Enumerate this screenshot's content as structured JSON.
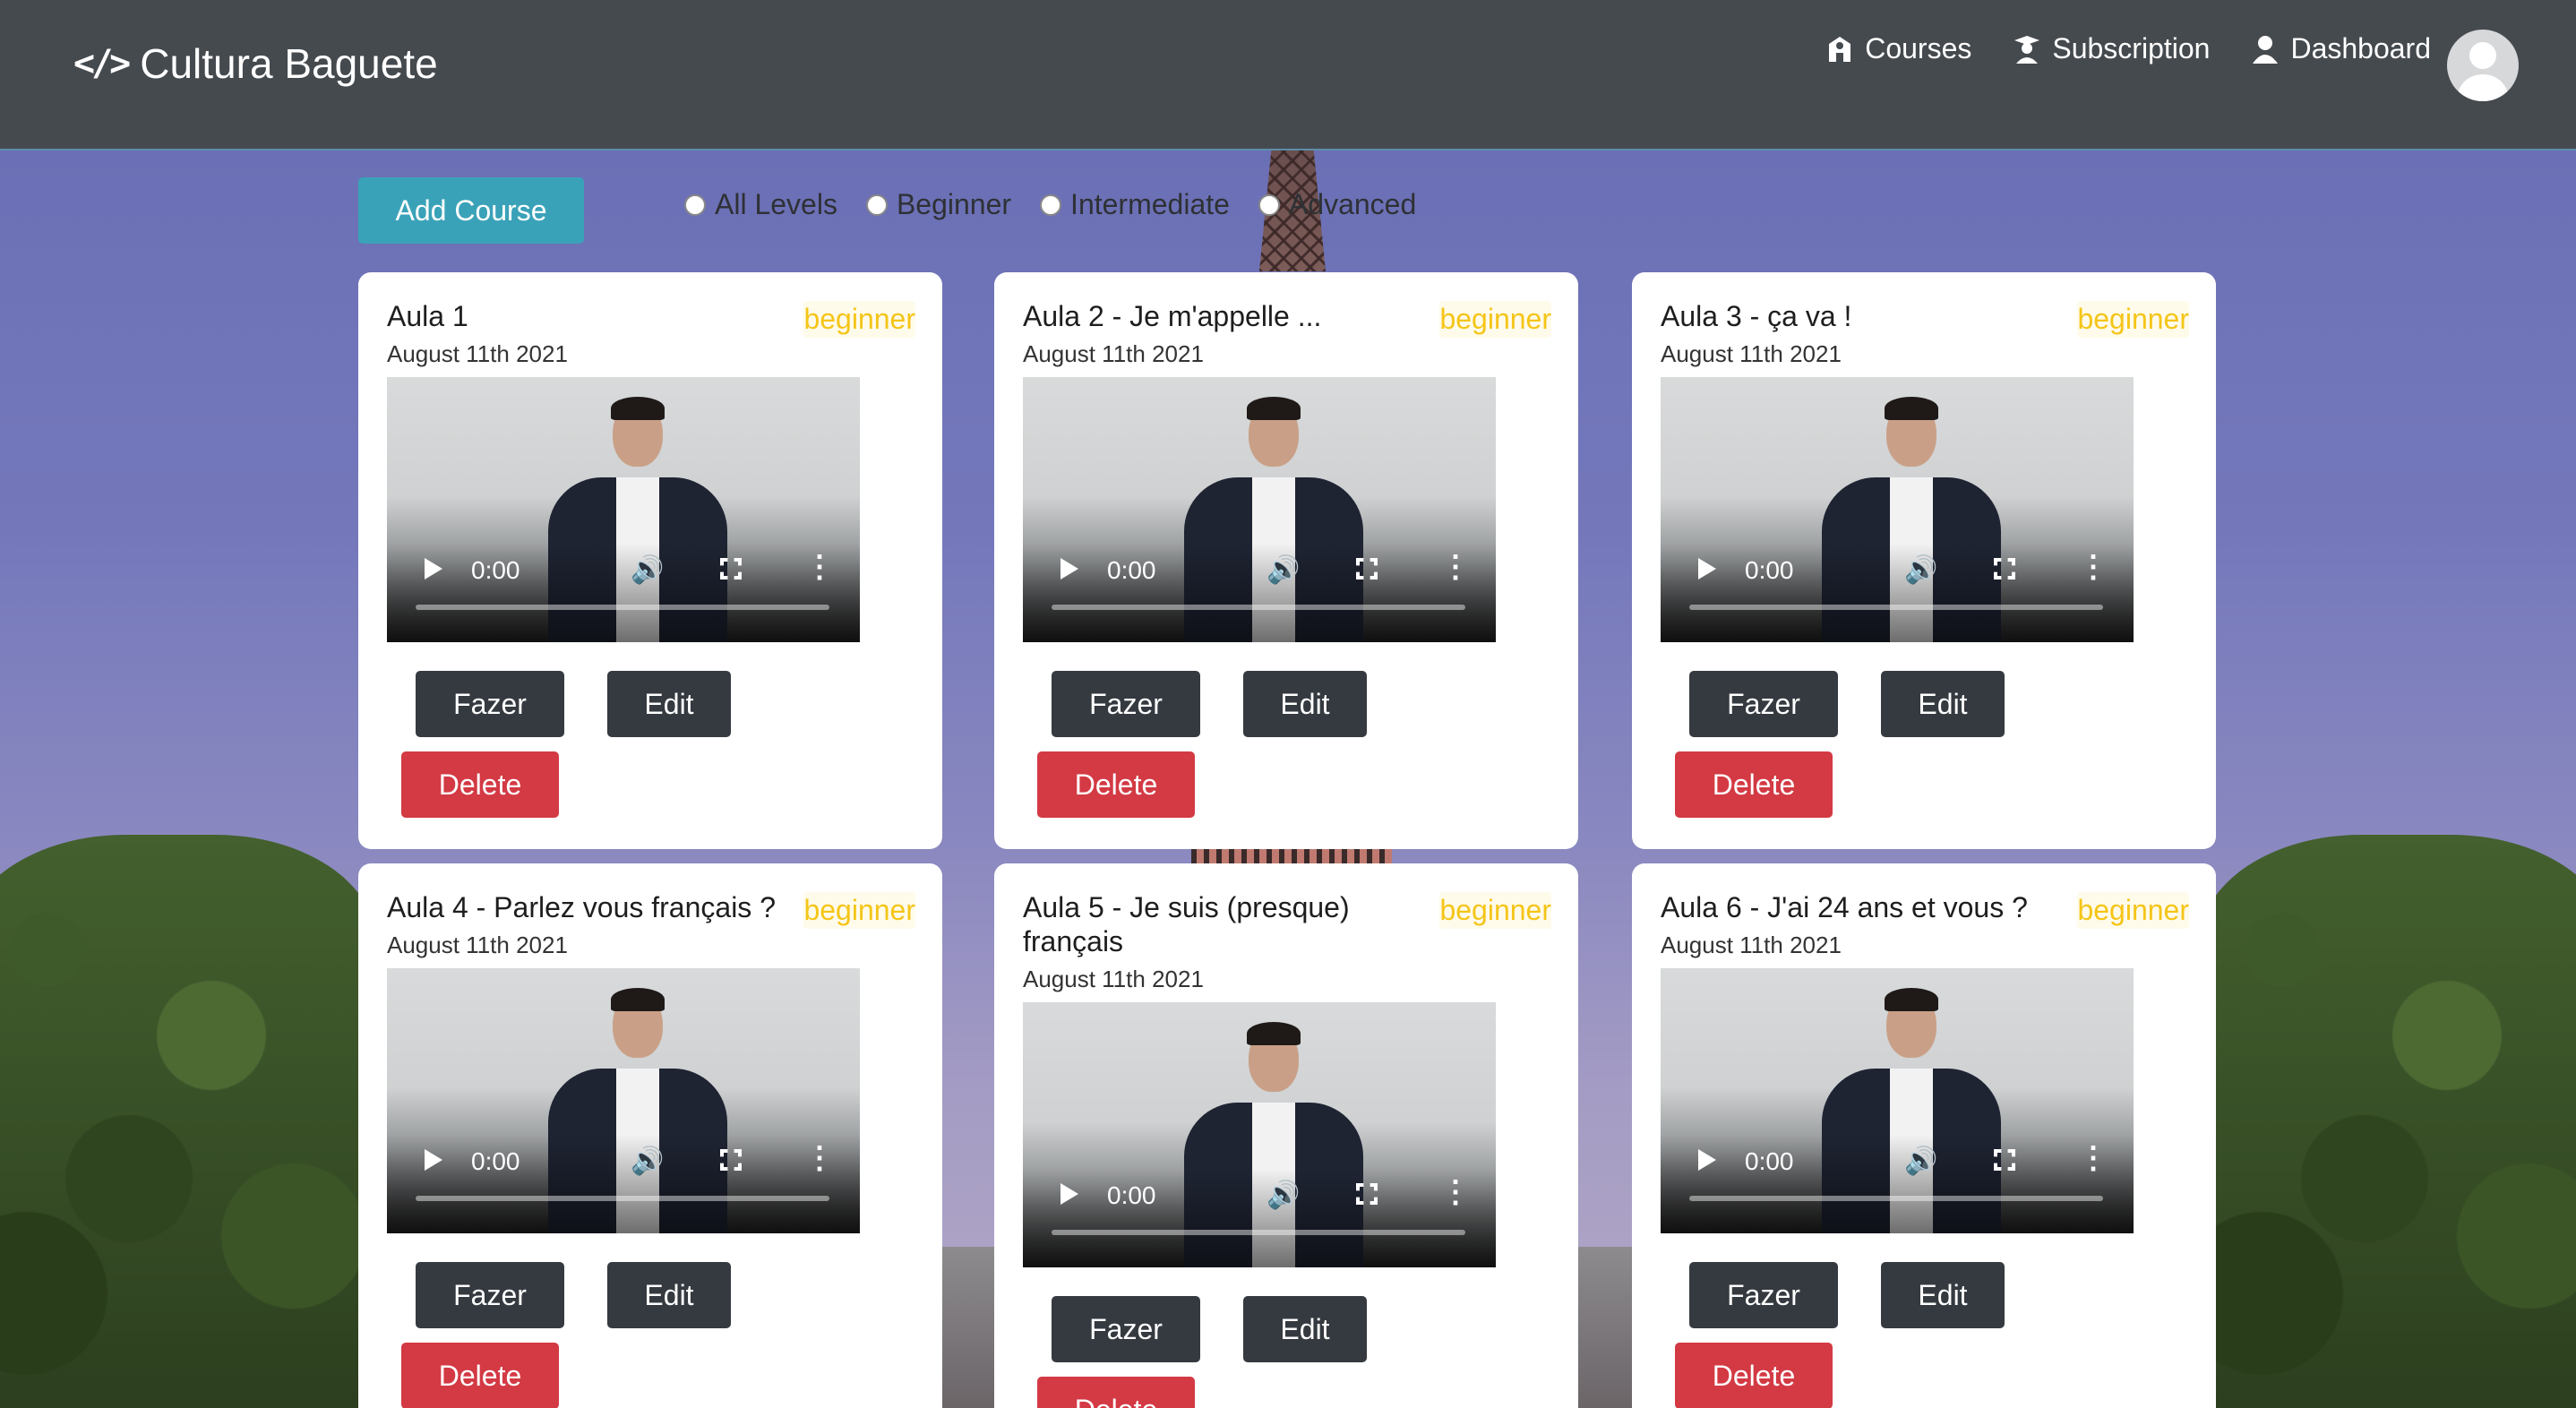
{
  "brand": {
    "icon": "</>",
    "name": "Cultura Baguete"
  },
  "nav": {
    "items": [
      {
        "label": "Courses",
        "icon": "school-icon"
      },
      {
        "label": "Subscription",
        "icon": "graduate-icon"
      },
      {
        "label": "Dashboard",
        "icon": "user-icon"
      }
    ],
    "avatar_icon": "user-avatar"
  },
  "toolbar": {
    "add_label": "Add Course",
    "filters": [
      "All Levels",
      "Beginner",
      "Intermediate",
      "Advanced"
    ]
  },
  "colors": {
    "navbar": "#454a4f",
    "add_button": "#3aa2b8",
    "badge": "#f5c518",
    "delete": "#d33a44",
    "dark_button": "#353a40"
  },
  "courses": [
    {
      "title": "Aula 1",
      "level": "beginner",
      "date": "August 11th 2021",
      "time": "0:00",
      "fazer": "Fazer",
      "edit": "Edit",
      "delete": "Delete"
    },
    {
      "title": "Aula 2 - Je m'appelle ...",
      "level": "beginner",
      "date": "August 11th 2021",
      "time": "0:00",
      "fazer": "Fazer",
      "edit": "Edit",
      "delete": "Delete"
    },
    {
      "title": "Aula 3 - ça va !",
      "level": "beginner",
      "date": "August 11th 2021",
      "time": "0:00",
      "fazer": "Fazer",
      "edit": "Edit",
      "delete": "Delete"
    },
    {
      "title": "Aula 4 - Parlez vous français ?",
      "level": "beginner",
      "date": "August 11th 2021",
      "time": "0:00",
      "fazer": "Fazer",
      "edit": "Edit",
      "delete": "Delete"
    },
    {
      "title": "Aula 5 - Je suis (presque) français",
      "level": "beginner",
      "date": "August 11th 2021",
      "time": "0:00",
      "fazer": "Fazer",
      "edit": "Edit",
      "delete": "Delete"
    },
    {
      "title": "Aula 6 - J'ai 24 ans et vous ?",
      "level": "beginner",
      "date": "August 11th 2021",
      "time": "0:00",
      "fazer": "Fazer",
      "edit": "Edit",
      "delete": "Delete"
    }
  ]
}
